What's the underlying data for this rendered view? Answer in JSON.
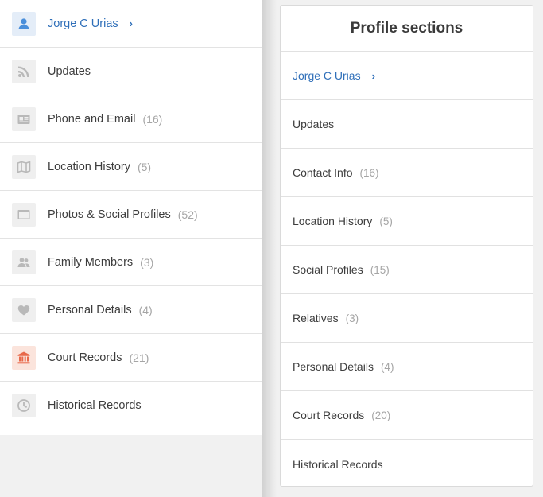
{
  "left_nav": {
    "items": [
      {
        "label": "Jorge C Urias",
        "count": "",
        "icon": "user-icon"
      },
      {
        "label": "Updates",
        "count": "",
        "icon": "rss-icon"
      },
      {
        "label": "Phone and Email",
        "count": "(16)",
        "icon": "contact-card-icon"
      },
      {
        "label": "Location History",
        "count": "(5)",
        "icon": "map-icon"
      },
      {
        "label": "Photos & Social Profiles",
        "count": "(52)",
        "icon": "photo-icon"
      },
      {
        "label": "Family Members",
        "count": "(3)",
        "icon": "people-icon"
      },
      {
        "label": "Personal Details",
        "count": "(4)",
        "icon": "heart-icon"
      },
      {
        "label": "Court Records",
        "count": "(21)",
        "icon": "courthouse-icon"
      },
      {
        "label": "Historical Records",
        "count": "",
        "icon": "clock-icon"
      }
    ]
  },
  "sections_card": {
    "title": "Profile sections",
    "items": [
      {
        "label": "Jorge C Urias",
        "count": ""
      },
      {
        "label": "Updates",
        "count": ""
      },
      {
        "label": "Contact Info",
        "count": "(16)"
      },
      {
        "label": "Location History",
        "count": "(5)"
      },
      {
        "label": "Social Profiles",
        "count": "(15)"
      },
      {
        "label": "Relatives",
        "count": "(3)"
      },
      {
        "label": "Personal Details",
        "count": "(4)"
      },
      {
        "label": "Court Records",
        "count": "(20)"
      },
      {
        "label": "Historical Records",
        "count": ""
      }
    ]
  },
  "colors": {
    "link": "#2f6fb9",
    "count": "#a5a5a5",
    "court_accent": "#e8694a"
  }
}
